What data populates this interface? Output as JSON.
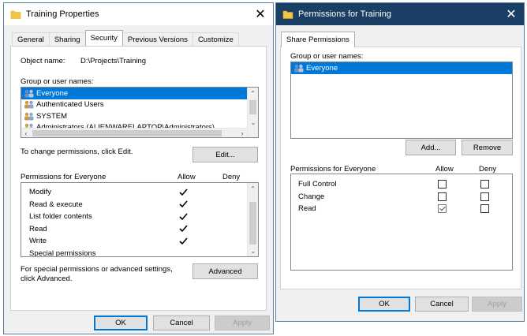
{
  "win1": {
    "title": "Training Properties",
    "tabs": [
      "General",
      "Sharing",
      "Security",
      "Previous Versions",
      "Customize"
    ],
    "active_tab": "Security",
    "object_name_label": "Object name:",
    "object_name_value": "D:\\Projects\\Training",
    "group_label": "Group or user names:",
    "users": [
      "Everyone",
      "Authenticated Users",
      "SYSTEM",
      "Administrators (ALIENWARELAPTOP\\Administrators)"
    ],
    "selected_user": "Everyone",
    "change_hint": "To change permissions, click Edit.",
    "edit_label": "Edit...",
    "perm_header": "Permissions for Everyone",
    "allow_label": "Allow",
    "deny_label": "Deny",
    "permissions": [
      {
        "name": "Modify",
        "allow": true,
        "deny": false
      },
      {
        "name": "Read & execute",
        "allow": true,
        "deny": false
      },
      {
        "name": "List folder contents",
        "allow": true,
        "deny": false
      },
      {
        "name": "Read",
        "allow": true,
        "deny": false
      },
      {
        "name": "Write",
        "allow": true,
        "deny": false
      },
      {
        "name": "Special permissions",
        "allow": false,
        "deny": false
      }
    ],
    "special_hint_1": "For special permissions or advanced settings,",
    "special_hint_2": "click Advanced.",
    "advanced_label": "Advanced",
    "ok_label": "OK",
    "cancel_label": "Cancel",
    "apply_label": "Apply"
  },
  "win2": {
    "title": "Permissions for Training",
    "tab": "Share Permissions",
    "group_label": "Group or user names:",
    "users": [
      "Everyone"
    ],
    "add_label": "Add...",
    "remove_label": "Remove",
    "perm_header": "Permissions for Everyone",
    "allow_label": "Allow",
    "deny_label": "Deny",
    "permissions": [
      {
        "name": "Full Control",
        "allow": false,
        "deny": false
      },
      {
        "name": "Change",
        "allow": false,
        "deny": false
      },
      {
        "name": "Read",
        "allow": true,
        "deny": false
      }
    ],
    "ok_label": "OK",
    "cancel_label": "Cancel",
    "apply_label": "Apply"
  },
  "colors": {
    "selection": "#0078d7",
    "title_bar_dark": "#1b3f64",
    "folder_icon": "#f4c542"
  },
  "icons": [
    "folder-icon",
    "close-icon",
    "users-icon",
    "checkmark-icon",
    "chevron-up-icon",
    "chevron-down-icon"
  ]
}
